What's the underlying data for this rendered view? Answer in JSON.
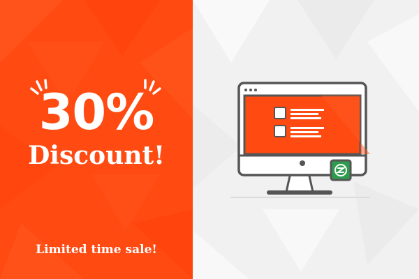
{
  "promo": {
    "percent": "30%",
    "headline": "Discount!",
    "footer": "Limited time sale!"
  },
  "colors": {
    "accent": "#ff4a12",
    "panel_bg": "#f1f1f1",
    "monitor_outline": "#555555",
    "badge": "#2e9c4d"
  },
  "icons": {
    "sparkle_left": "sparkle-lines-icon",
    "sparkle_right": "sparkle-lines-icon",
    "monitor": "desktop-monitor-icon",
    "badge": "green-s-badge-icon"
  }
}
